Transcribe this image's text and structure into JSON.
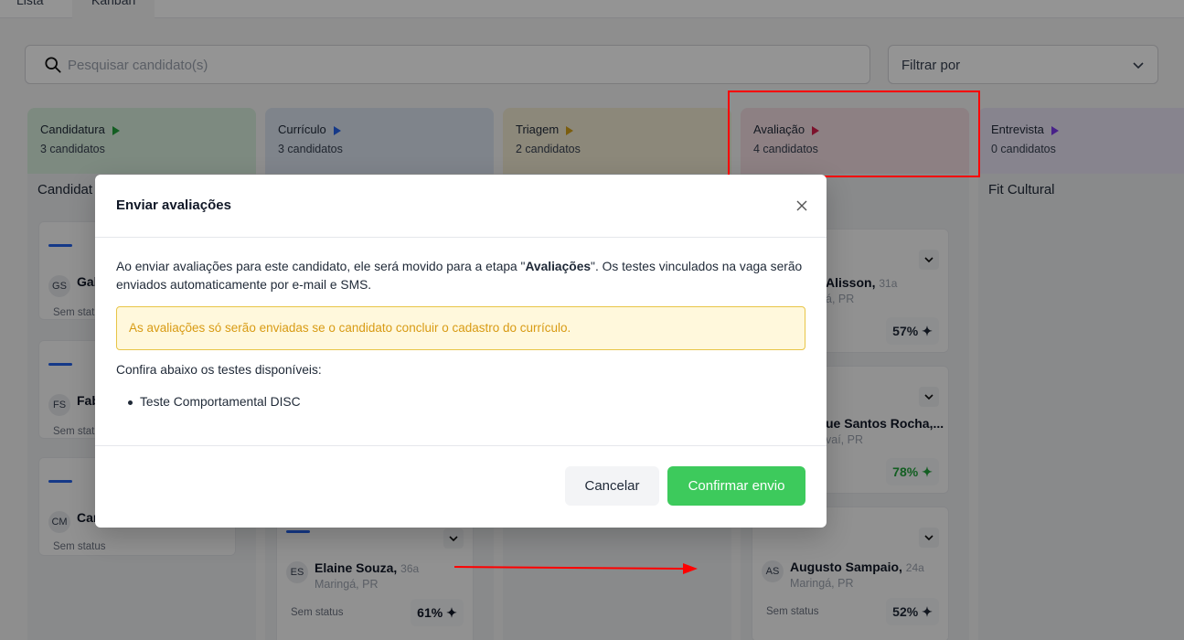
{
  "tabs": [
    "Lista",
    "Kanban"
  ],
  "search": {
    "placeholder": "Pesquisar candidato(s)"
  },
  "filter": {
    "label": "Filtrar por"
  },
  "columns": [
    {
      "title": "Candidatura",
      "count": "3 candidatos",
      "subtitle": "Candidat",
      "color": "#d8eedc",
      "tri": "#22a33b"
    },
    {
      "title": "Currículo",
      "count": "3 candidatos",
      "subtitle": "",
      "color": "#dbe4f0",
      "tri": "#2563eb"
    },
    {
      "title": "Triagem",
      "count": "2 candidatos",
      "subtitle": "",
      "color": "#f2ebd3",
      "tri": "#d4a017"
    },
    {
      "title": "Avaliação",
      "count": "4 candidatos",
      "subtitle": "",
      "color": "#f3dde2",
      "tri": "#d6204d"
    },
    {
      "title": "Entrevista",
      "count": "0 candidatos",
      "subtitle": "Fit Cultural",
      "color": "#e9e4f5",
      "tri": "#7c3aed"
    }
  ],
  "cards_col1": [
    {
      "initials": "GS",
      "name": "Gab",
      "status": "Sem stat"
    },
    {
      "initials": "FS",
      "name": "Fab",
      "status": "Sem stat"
    },
    {
      "initials": "CM",
      "name": "Car",
      "status": "Sem status"
    }
  ],
  "card_col2": {
    "initials": "ES",
    "name": "Elaine Souza,",
    "age": "36a",
    "city": "Maringá, PR",
    "status": "Sem status",
    "score": "61%"
  },
  "cards_col4": [
    {
      "initials": "",
      "name": "Alisson,",
      "age": "31a",
      "city": "á, PR",
      "status": "",
      "score": "57%",
      "score_color": "#111827"
    },
    {
      "initials": "",
      "name": "ue Santos Rocha,...",
      "age": "",
      "city": "vaí, PR",
      "status": "",
      "score": "78%",
      "score_color": "#22a33b"
    },
    {
      "initials": "AS",
      "name": "Augusto Sampaio,",
      "age": "24a",
      "city": "Maringá, PR",
      "status": "Sem status",
      "score": "52%",
      "score_color": "#111827"
    }
  ],
  "modal": {
    "title": "Enviar avaliações",
    "body_pre": "Ao enviar avaliações para este candidato, ele será movido para a etapa \"",
    "body_bold": "Avaliações",
    "body_post": "\". Os testes vinculados na vaga serão enviados automaticamente por e-mail e SMS.",
    "warning": "As avaliações só serão enviadas se o candidato concluir o cadastro do currículo.",
    "confira": "Confira abaixo os testes disponíveis:",
    "tests": [
      "Teste Comportamental DISC"
    ],
    "cancel": "Cancelar",
    "confirm": "Confirmar envio"
  }
}
